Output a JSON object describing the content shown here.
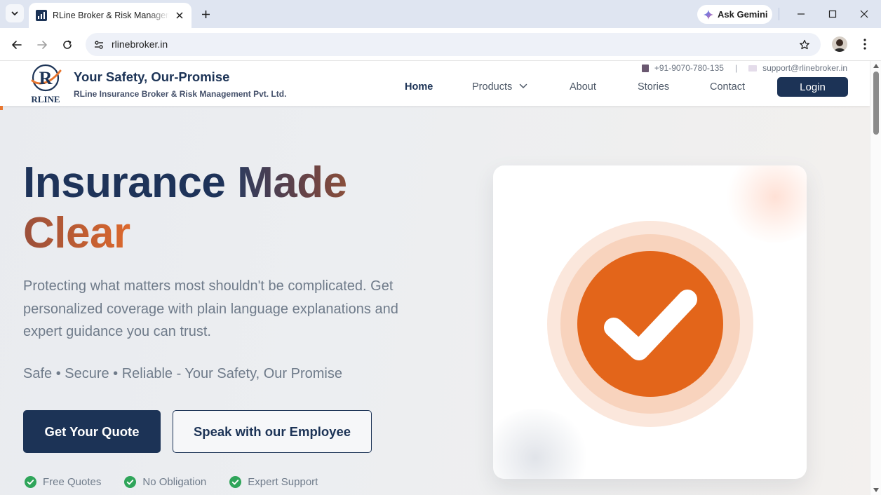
{
  "browser": {
    "tab_title": "RLine Broker & Risk Management",
    "url": "rlinebroker.in",
    "ask_gemini": "Ask Gemini"
  },
  "header": {
    "logo_text": "RLINE",
    "brand_title": "Your Safety, Our-Promise",
    "brand_subtitle": "RLine Insurance Broker & Risk Management Pvt. Ltd.",
    "phone": "+91-9070-780-135",
    "email": "support@rlinebroker.in",
    "nav": [
      "Home",
      "Products",
      "About",
      "Stories",
      "Contact"
    ],
    "login": "Login"
  },
  "hero": {
    "title_part1": "Insurance ",
    "title_part2": "Made",
    "title_part3": "Clear",
    "description": "Protecting what matters most shouldn't be complicated. Get personalized coverage with plain language explanations and expert guidance you can trust.",
    "tagline": "Safe • Secure • Reliable - Your Safety, Our Promise",
    "primary_cta": "Get Your Quote",
    "secondary_cta": "Speak with our Employee",
    "features": [
      "Free Quotes",
      "No Obligation",
      "Expert Support"
    ]
  },
  "colors": {
    "navy": "#1c3356",
    "orange": "#e3651a",
    "check_green": "#2fa55a"
  }
}
